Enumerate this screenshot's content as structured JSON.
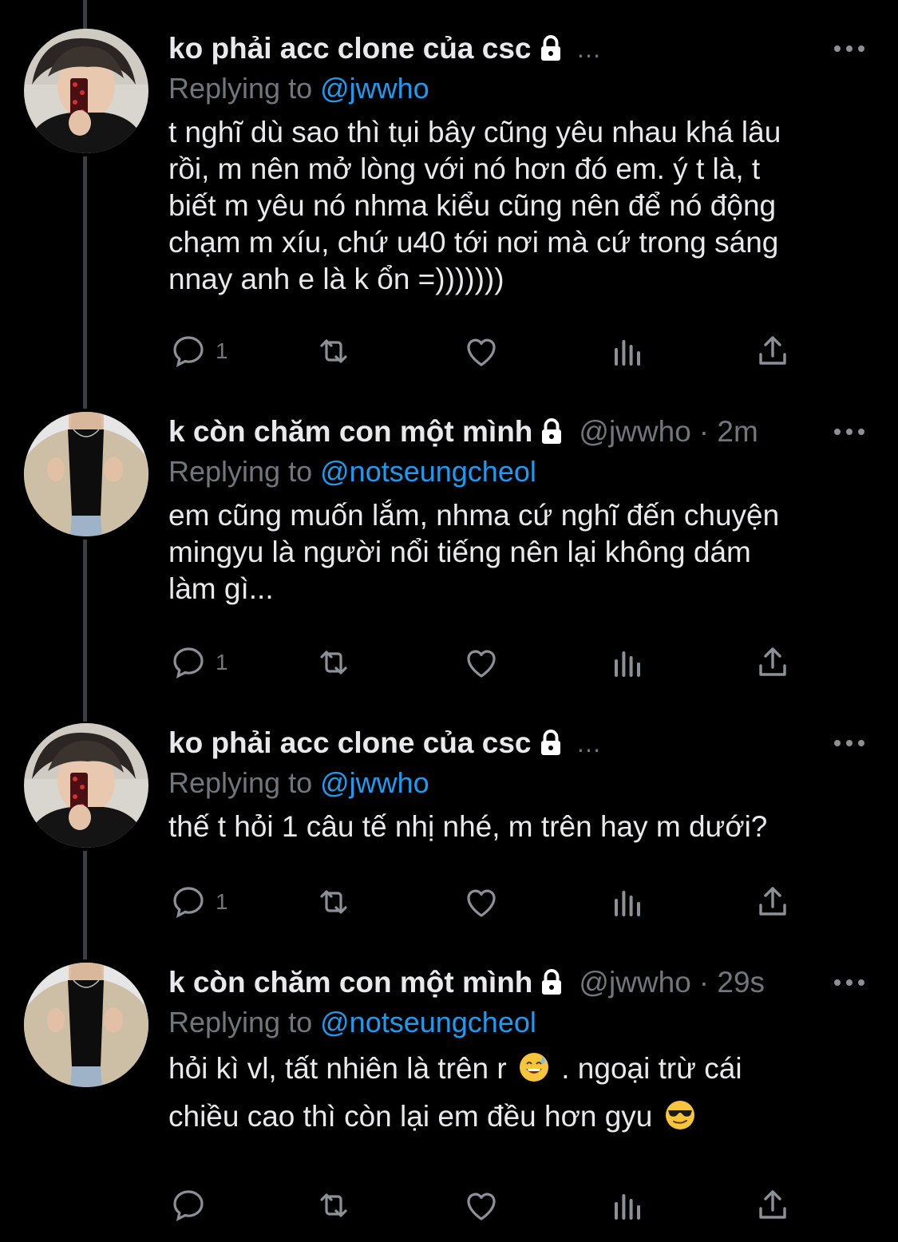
{
  "tweets": [
    {
      "name": "ko phải acc clone của csc",
      "handle": "",
      "time": "",
      "ellipsis": "…",
      "reply_label": "Replying to",
      "reply_to": "@jwwho",
      "text_lines": [
        "t nghĩ dù sao thì tụi bây cũng yêu nhau khá lâu",
        "rồi, m nên mở lòng với nó hơn đó em. ý t là, t",
        "biết m yêu nó nhma kiểu cũng nên để nó động",
        "chạm m xíu, chứ u40 tới nơi mà cứ trong sáng",
        "nnay anh e là k ổn =)))))))"
      ],
      "reply_count": "1"
    },
    {
      "name": "k còn chăm con một mình",
      "handle": "@jwwho",
      "time": "· 2m",
      "ellipsis": "",
      "reply_label": "Replying to",
      "reply_to": "@notseungcheol",
      "text_lines": [
        "em cũng muốn lắm, nhma cứ nghĩ đến chuyện",
        "mingyu là người nổi tiếng nên lại không dám",
        "làm gì..."
      ],
      "reply_count": "1"
    },
    {
      "name": "ko phải acc clone của csc",
      "handle": "",
      "time": "",
      "ellipsis": "…",
      "reply_label": "Replying to",
      "reply_to": "@jwwho",
      "text_lines": [
        "thế t hỏi 1 câu tế nhị nhé, m trên hay m dưới?"
      ],
      "reply_count": "1"
    },
    {
      "name": "k còn chăm con một mình",
      "handle": "@jwwho",
      "time": "· 29s",
      "ellipsis": "",
      "reply_label": "Replying to",
      "reply_to": "@notseungcheol",
      "text_lines": [
        "hỏi kì vl, tất nhiên là trên r",
        ". ngoại trừ cái",
        "chiều cao thì còn lại em đều hơn gyu"
      ],
      "reply_count": ""
    }
  ],
  "icons": {
    "lock": "lock-icon",
    "more": "more-dots-icon",
    "reply": "reply-icon",
    "retweet": "retweet-icon",
    "like": "like-icon",
    "analytics": "analytics-icon",
    "share": "share-icon",
    "emoji1": "sweat-smile-emoji-icon",
    "emoji2": "sunglasses-emoji-icon"
  },
  "colors": {
    "background": "#000000",
    "text": "#e7e9ea",
    "muted": "#71767b",
    "link": "#1d9bf0",
    "thread_line": "#3a3f44"
  }
}
